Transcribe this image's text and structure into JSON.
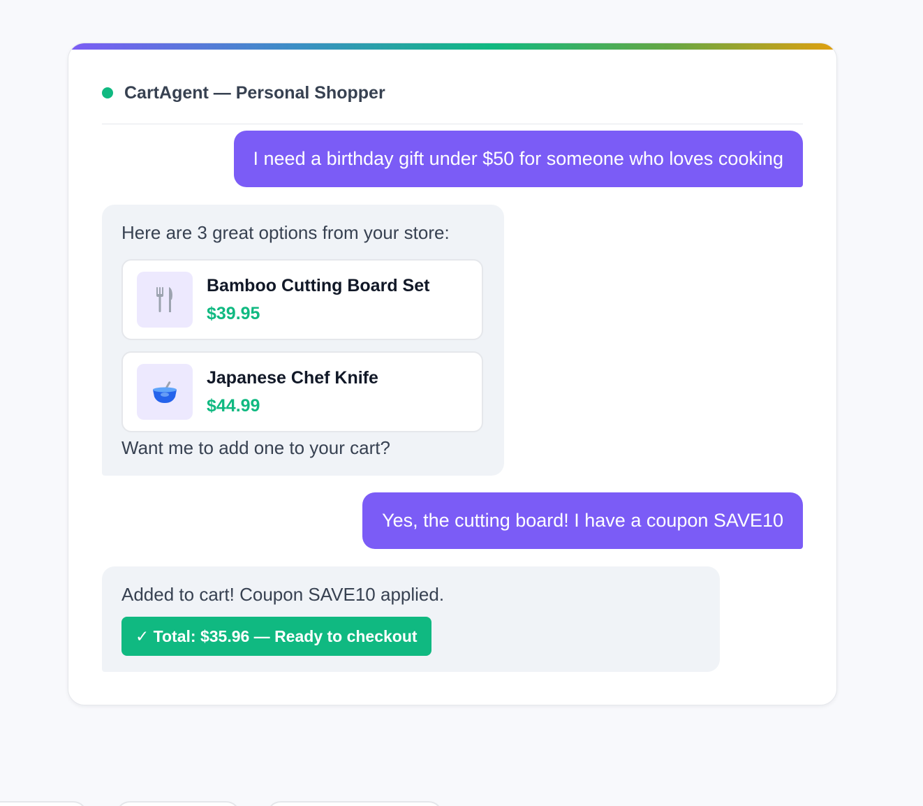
{
  "header": {
    "title": "CartAgent — Personal Shopper",
    "status_color": "#10b981"
  },
  "messages": {
    "user_1": "I need a birthday gift under $50 for someone who loves cooking",
    "agent_1": {
      "intro": "Here are 3 great options from your store:",
      "products": [
        {
          "name": "Bamboo Cutting Board Set",
          "price": "$39.95",
          "icon": "fork-and-knife-icon"
        },
        {
          "name": "Japanese Chef Knife",
          "price": "$44.99",
          "icon": "mixing-bowl-icon"
        }
      ],
      "outro": "Want me to add one to your cart?"
    },
    "user_2": "Yes, the cutting board! I have a coupon SAVE10",
    "agent_2": {
      "text": "Added to cart! Coupon SAVE10 applied.",
      "badge": "✓ Total: $35.96 — Ready to checkout"
    }
  },
  "colors": {
    "user_bubble": "#7b5cf6",
    "agent_bubble": "#f0f3f7",
    "price": "#10b981",
    "badge": "#10b981"
  }
}
